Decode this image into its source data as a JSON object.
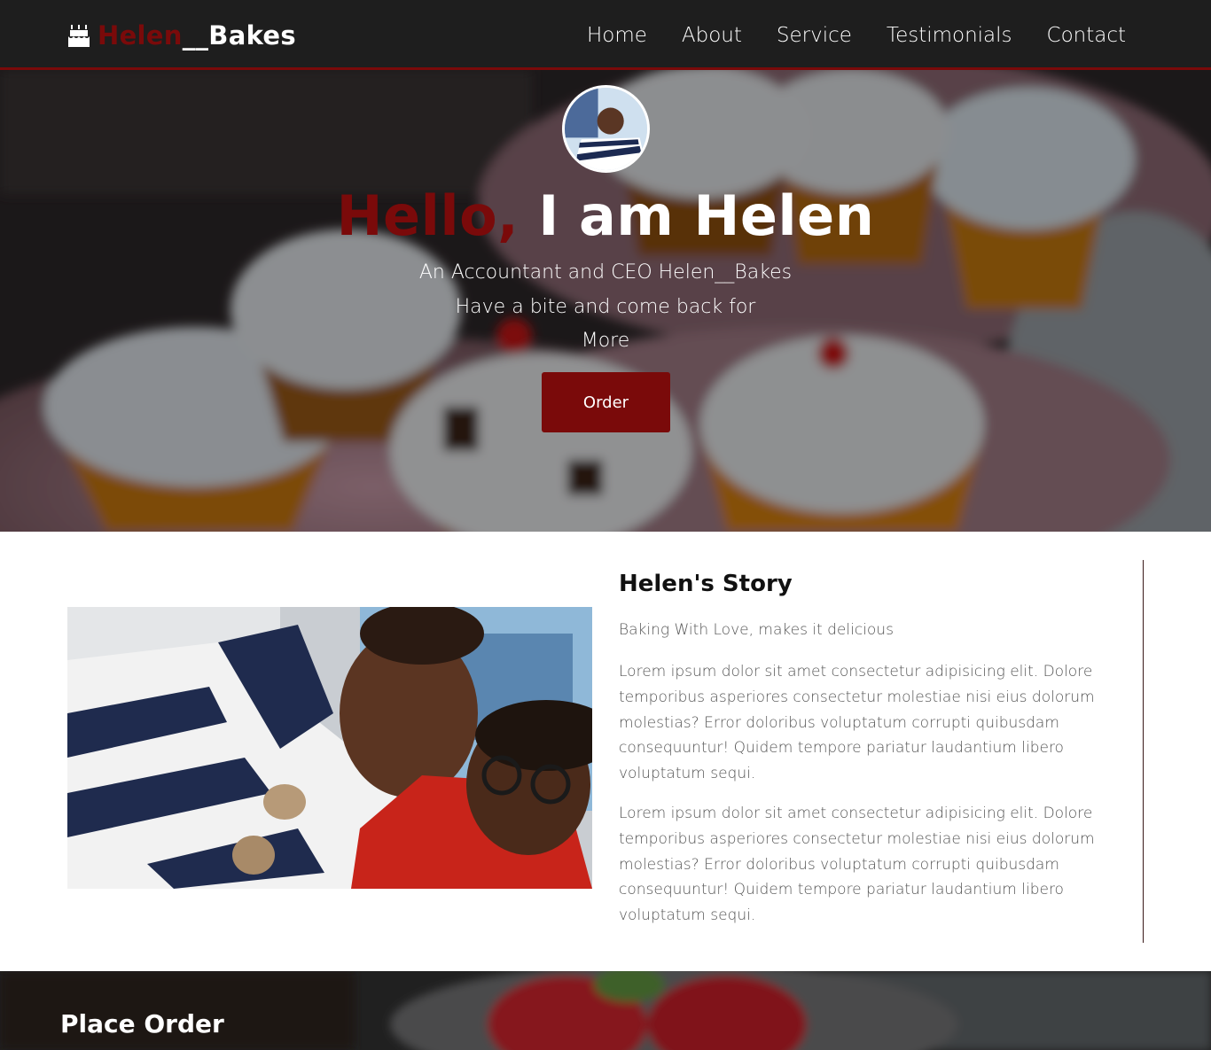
{
  "nav": {
    "brand_red": "Helen",
    "brand_white": "__Bakes",
    "brand_icon": "birthday-cake-icon",
    "links": [
      "Home",
      "About",
      "Service",
      "Testimonials",
      "Contact"
    ]
  },
  "hero": {
    "title_highlight": "Hello,",
    "title_rest": " I am Helen",
    "subtitle_line1": "An Accountant and CEO Helen__Bakes",
    "subtitle_line2": "Have a bite and come back for",
    "subtitle_line3": "More",
    "order_label": "Order"
  },
  "story": {
    "title": "Helen's Story",
    "tagline": "Baking With Love, makes it delicious",
    "paragraph1": "Lorem ipsum dolor sit amet consectetur adipisicing elit. Dolore temporibus asperiores consectetur molestiae nisi eius dolorum molestias? Error doloribus voluptatum corrupti quibusdam consequuntur! Quidem tempore pariatur laudantium libero voluptatum sequi.",
    "paragraph2": "Lorem ipsum dolor sit amet consectetur adipisicing elit. Dolore temporibus asperiores consectetur molestiae nisi eius dolorum molestias? Error doloribus voluptatum corrupti quibusdam consequuntur! Quidem tempore pariatur laudantium libero voluptatum sequi."
  },
  "order_section": {
    "title": "Place Order"
  },
  "colors": {
    "accent": "#7a0a0a",
    "nav_bg": "#1e1e1e",
    "text_muted": "#555555"
  }
}
